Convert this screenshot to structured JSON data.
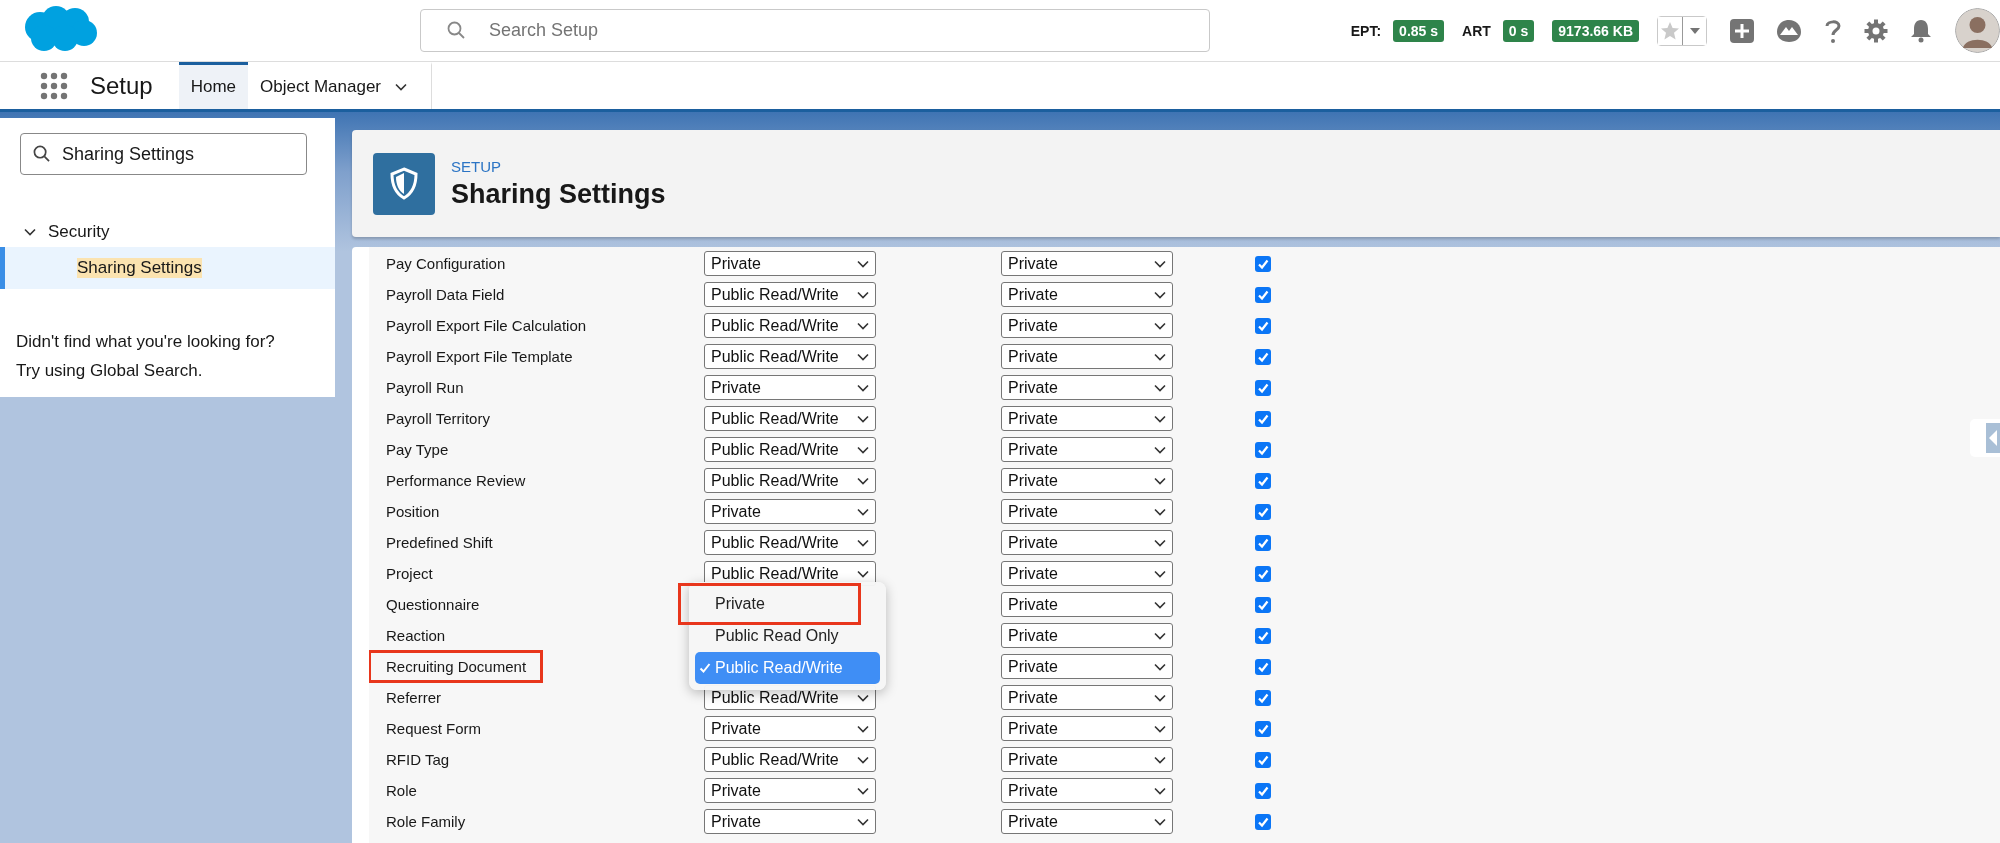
{
  "header": {
    "search": {
      "placeholder": "Search Setup"
    },
    "metrics": [
      {
        "label": "EPT:",
        "value": "0.85 s"
      },
      {
        "label": "ART",
        "value": "0 s"
      },
      {
        "value": "9173.66 KB"
      }
    ]
  },
  "nav": {
    "app_name": "Setup",
    "tabs": [
      {
        "label": "Home",
        "selected": true,
        "kind": "link"
      },
      {
        "label": "Object Manager",
        "selected": false,
        "kind": "menu"
      }
    ]
  },
  "sidebar": {
    "search": {
      "value": "Sharing Settings"
    },
    "tree": [
      {
        "label": "Security",
        "expanded": true,
        "children": [
          {
            "label": "Sharing Settings",
            "selected": true
          }
        ]
      }
    ],
    "help_text": [
      "Didn't find what you're looking for?",
      "Try using Global Search."
    ]
  },
  "page_header": {
    "eyebrow": "SETUP",
    "title": "Sharing Settings"
  },
  "table": {
    "rows": [
      {
        "label": "Pay Configuration",
        "highlighted": false,
        "default_access": "Private",
        "access_2": "Private",
        "checked": true
      },
      {
        "label": "Payroll Data Field",
        "highlighted": false,
        "default_access": "Public Read/Write",
        "access_2": "Private",
        "checked": true
      },
      {
        "label": "Payroll Export File Calculation",
        "highlighted": false,
        "default_access": "Public Read/Write",
        "access_2": "Private",
        "checked": true
      },
      {
        "label": "Payroll Export File Template",
        "highlighted": false,
        "default_access": "Public Read/Write",
        "access_2": "Private",
        "checked": true
      },
      {
        "label": "Payroll Run",
        "highlighted": false,
        "default_access": "Private",
        "access_2": "Private",
        "checked": true
      },
      {
        "label": "Payroll Territory",
        "highlighted": false,
        "default_access": "Public Read/Write",
        "access_2": "Private",
        "checked": true
      },
      {
        "label": "Pay Type",
        "highlighted": false,
        "default_access": "Public Read/Write",
        "access_2": "Private",
        "checked": true
      },
      {
        "label": "Performance Review",
        "highlighted": false,
        "default_access": "Public Read/Write",
        "access_2": "Private",
        "checked": true
      },
      {
        "label": "Position",
        "highlighted": false,
        "default_access": "Private",
        "access_2": "Private",
        "checked": true
      },
      {
        "label": "Predefined Shift",
        "highlighted": false,
        "default_access": "Public Read/Write",
        "access_2": "Private",
        "checked": true
      },
      {
        "label": "Project",
        "highlighted": false,
        "default_access": "Public Read/Write",
        "access_2": "Private",
        "checked": true
      },
      {
        "label": "Questionnaire",
        "highlighted": false,
        "access_2": "Private",
        "checked": true
      },
      {
        "label": "Reaction",
        "highlighted": false,
        "access_2": "Private",
        "checked": true
      },
      {
        "label": "Recruiting Document",
        "highlighted": true,
        "access_2": "Private",
        "checked": true,
        "menu": [
          {
            "label": "Private",
            "selected": false,
            "highlighted": true
          },
          {
            "label": "Public Read Only",
            "selected": false,
            "highlighted": false
          },
          {
            "label": "Public Read/Write",
            "selected": true,
            "highlighted": false
          }
        ]
      },
      {
        "label": "Referrer",
        "highlighted": false,
        "default_access": "Public Read/Write",
        "access_2": "Private",
        "checked": true
      },
      {
        "label": "Request Form",
        "highlighted": false,
        "default_access": "Private",
        "access_2": "Private",
        "checked": true
      },
      {
        "label": "RFID Tag",
        "highlighted": false,
        "default_access": "Public Read/Write",
        "access_2": "Private",
        "checked": true
      },
      {
        "label": "Role",
        "highlighted": false,
        "default_access": "Private",
        "access_2": "Private",
        "checked": true
      },
      {
        "label": "Role Family",
        "highlighted": false,
        "default_access": "Private",
        "access_2": "Private",
        "checked": true
      }
    ]
  }
}
